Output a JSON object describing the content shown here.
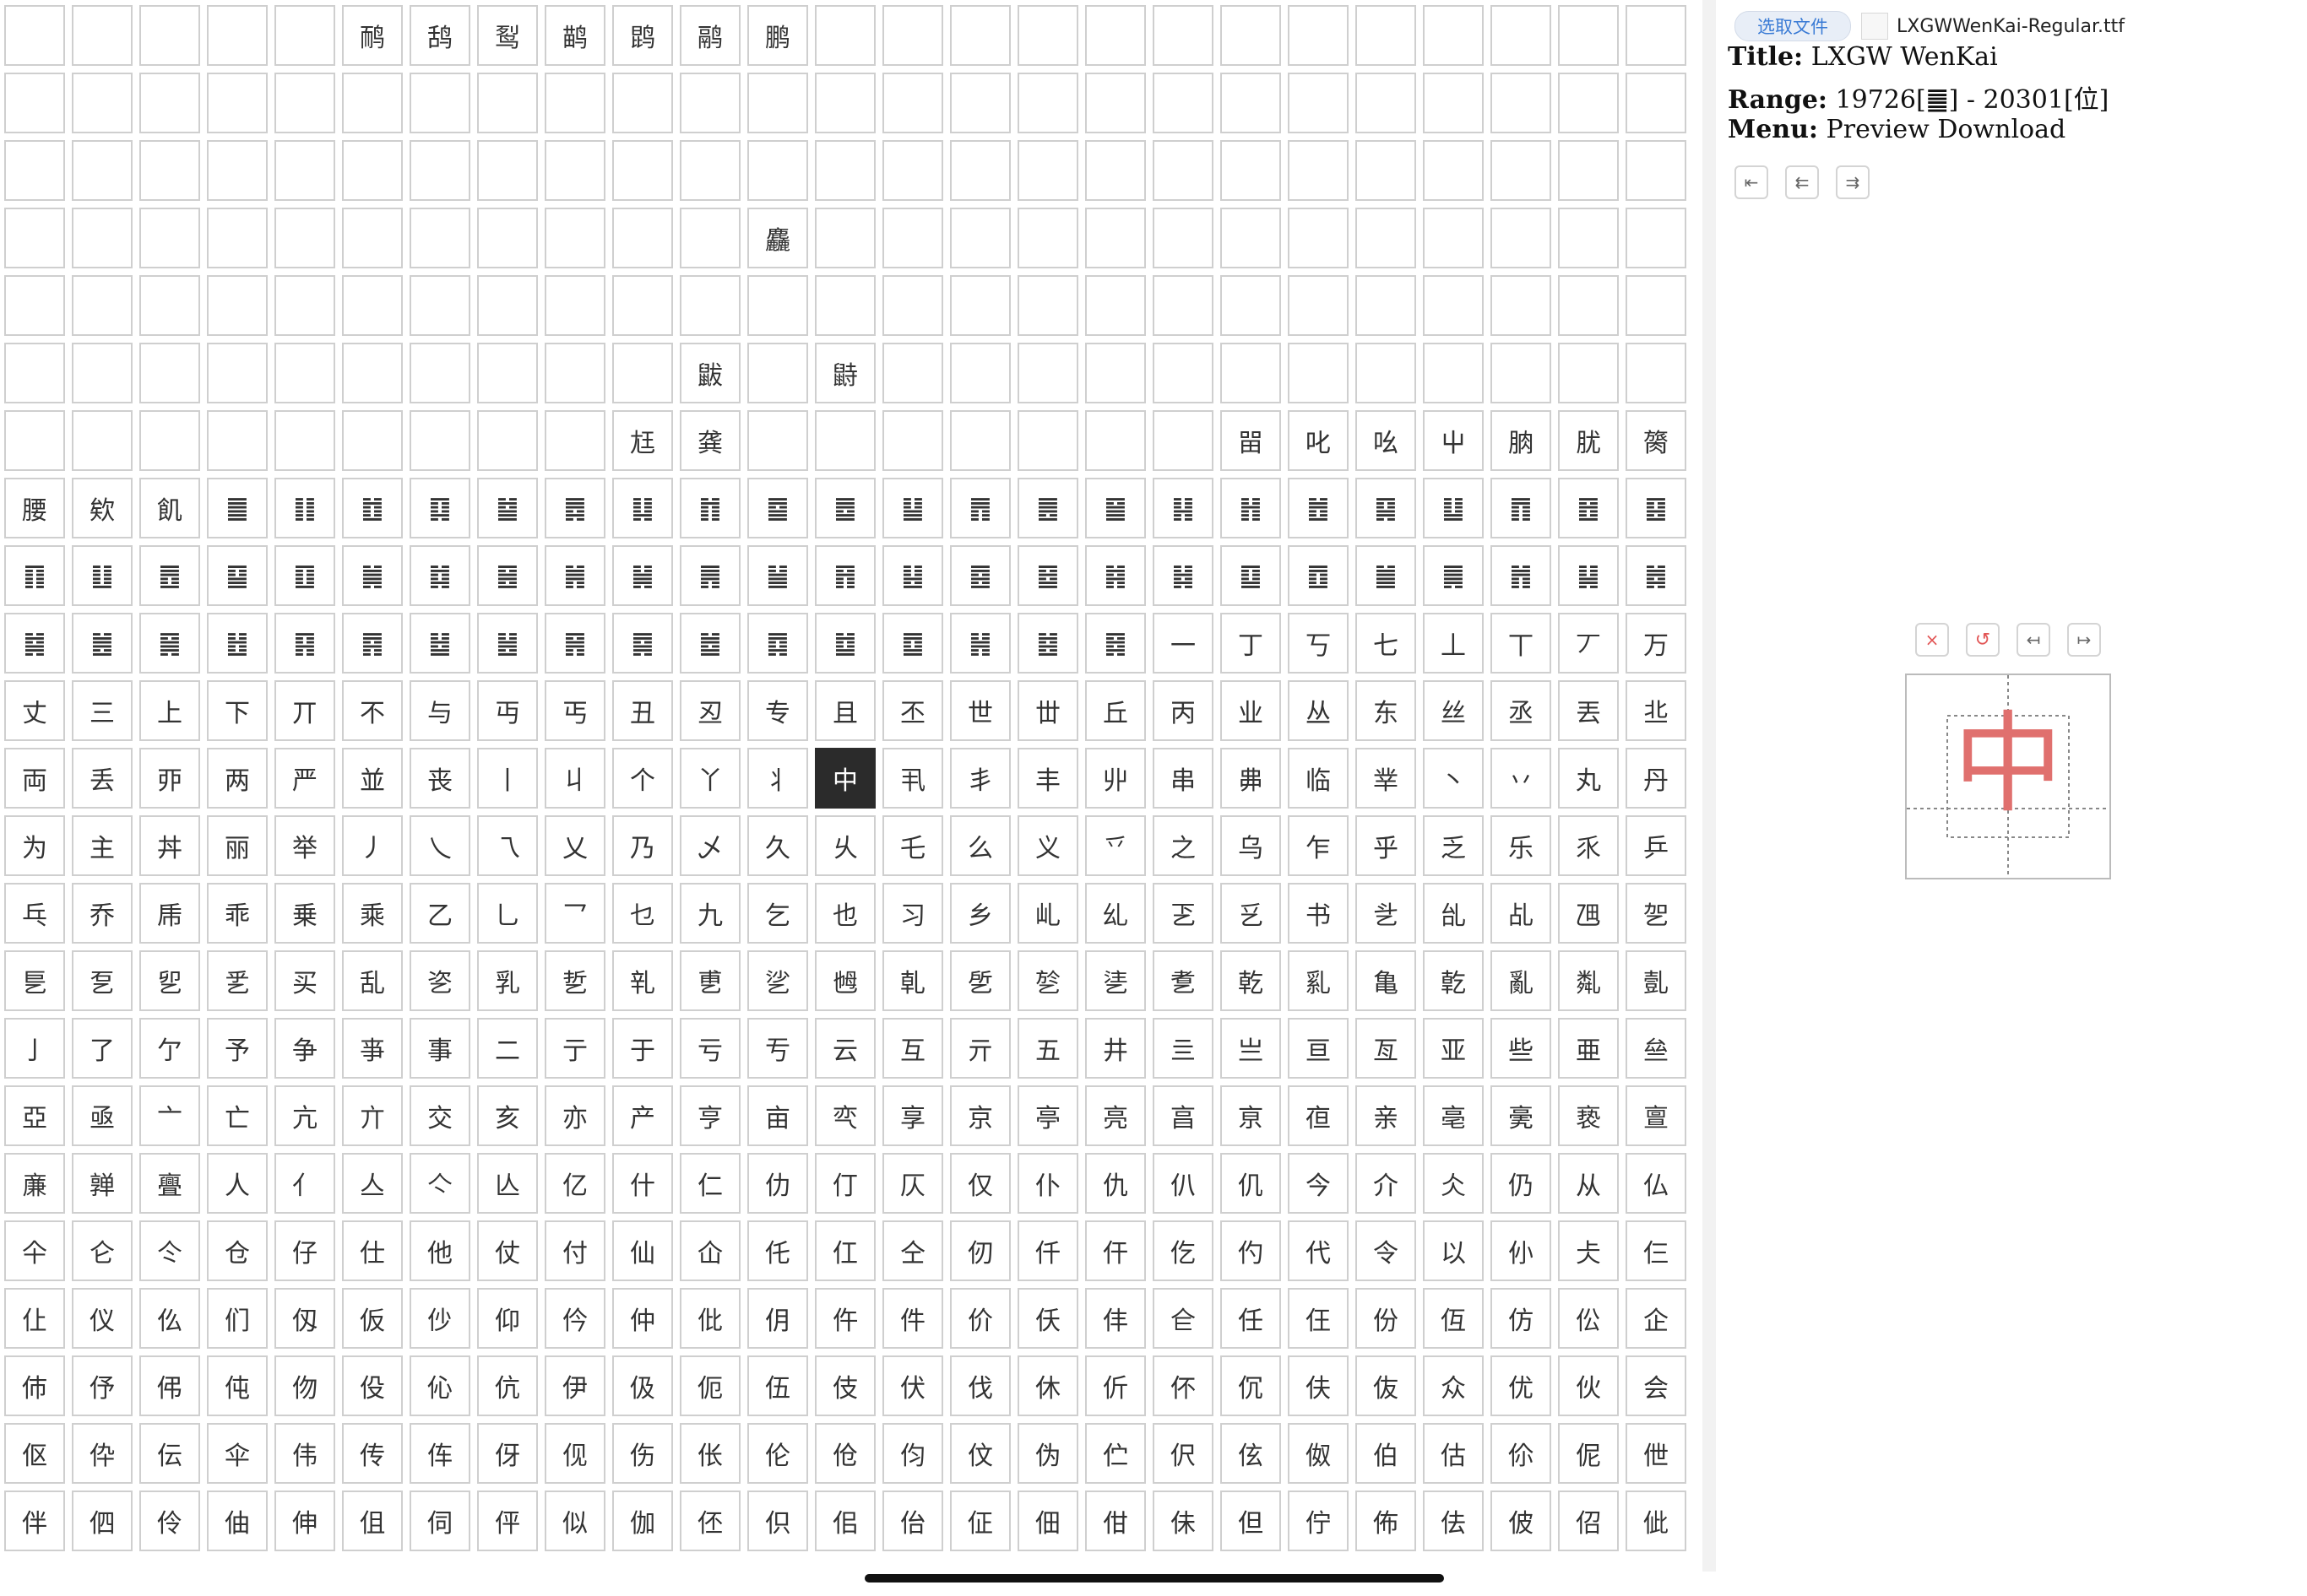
{
  "grid": {
    "selected_index": 287,
    "rows": [
      [
        "",
        "",
        "",
        "",
        "",
        "鸸",
        "鸹",
        "䴕",
        "鹋",
        "鹍",
        "鹝",
        "鹏",
        "",
        "",
        "",
        "",
        "",
        "",
        "",
        "",
        "",
        "",
        "",
        "",
        ""
      ],
      [
        "",
        "",
        "",
        "",
        "",
        "",
        "",
        "",
        "",
        "",
        "",
        "",
        "",
        "",
        "",
        "",
        "",
        "",
        "",
        "",
        "",
        "",
        "",
        "",
        ""
      ],
      [
        "",
        "",
        "",
        "",
        "",
        "",
        "",
        "",
        "",
        "",
        "",
        "",
        "",
        "",
        "",
        "",
        "",
        "",
        "",
        "",
        "",
        "",
        "",
        "",
        ""
      ],
      [
        "",
        "",
        "",
        "",
        "",
        "",
        "",
        "",
        "",
        "",
        "",
        "麤",
        "",
        "",
        "",
        "",
        "",
        "",
        "",
        "",
        "",
        "",
        "",
        "",
        ""
      ],
      [
        "",
        "",
        "",
        "",
        "",
        "",
        "",
        "",
        "",
        "",
        "",
        "",
        "",
        "",
        "",
        "",
        "",
        "",
        "",
        "",
        "",
        "",
        "",
        "",
        ""
      ],
      [
        "",
        "",
        "",
        "",
        "",
        "",
        "",
        "",
        "",
        "",
        "鼥",
        "",
        "鼭",
        "",
        "",
        "",
        "",
        "",
        "",
        "",
        "",
        "",
        "",
        "",
        ""
      ],
      [
        "",
        "",
        "",
        "",
        "",
        "",
        "",
        "",
        "",
        "尪",
        "龚",
        "",
        "",
        "",
        "",
        "",
        "",
        "",
        "㽞",
        "叱",
        "吆",
        "屮",
        "朒",
        "肬",
        "膐"
      ],
      [
        "腰",
        "欸",
        "飢",
        "䷀",
        "䷁",
        "䷂",
        "䷃",
        "䷄",
        "䷅",
        "䷆",
        "䷇",
        "䷈",
        "䷉",
        "䷊",
        "䷋",
        "䷌",
        "䷍",
        "䷎",
        "䷏",
        "䷐",
        "䷑",
        "䷒",
        "䷓",
        "䷔",
        "䷕"
      ],
      [
        "䷖",
        "䷗",
        "䷘",
        "䷙",
        "䷚",
        "䷛",
        "䷜",
        "䷝",
        "䷞",
        "䷟",
        "䷠",
        "䷡",
        "䷢",
        "䷣",
        "䷤",
        "䷥",
        "䷦",
        "䷧",
        "䷨",
        "䷩",
        "䷪",
        "䷫",
        "䷬",
        "䷭",
        "䷮"
      ],
      [
        "䷯",
        "䷰",
        "䷱",
        "䷲",
        "䷳",
        "䷴",
        "䷵",
        "䷶",
        "䷷",
        "䷸",
        "䷹",
        "䷺",
        "䷻",
        "䷼",
        "䷽",
        "䷾",
        "䷿",
        "一",
        "丁",
        "丂",
        "七",
        "丄",
        "丅",
        "丆",
        "万"
      ],
      [
        "丈",
        "三",
        "上",
        "下",
        "丌",
        "不",
        "与",
        "丏",
        "丐",
        "丑",
        "丒",
        "专",
        "且",
        "丕",
        "世",
        "丗",
        "丘",
        "丙",
        "业",
        "丛",
        "东",
        "丝",
        "丞",
        "丟",
        "丠"
      ],
      [
        "両",
        "丢",
        "丣",
        "两",
        "严",
        "並",
        "丧",
        "丨",
        "丩",
        "个",
        "丫",
        "丬",
        "中",
        "丮",
        "丯",
        "丰",
        "丱",
        "串",
        "丳",
        "临",
        "丵",
        "丶",
        "丷",
        "丸",
        "丹"
      ],
      [
        "为",
        "主",
        "丼",
        "丽",
        "举",
        "丿",
        "乀",
        "乁",
        "乂",
        "乃",
        "乄",
        "久",
        "乆",
        "乇",
        "么",
        "义",
        "乊",
        "之",
        "乌",
        "乍",
        "乎",
        "乏",
        "乐",
        "乑",
        "乒"
      ],
      [
        "乓",
        "乔",
        "乕",
        "乖",
        "乗",
        "乘",
        "乙",
        "乚",
        "乛",
        "乜",
        "九",
        "乞",
        "也",
        "习",
        "乡",
        "乢",
        "乣",
        "乤",
        "乥",
        "书",
        "乧",
        "乨",
        "乩",
        "乪",
        "乫"
      ],
      [
        "乬",
        "乭",
        "乮",
        "乯",
        "买",
        "乱",
        "乲",
        "乳",
        "乴",
        "乵",
        "乶",
        "乷",
        "乸",
        "乹",
        "乺",
        "乻",
        "乼",
        "乽",
        "乾",
        "乿",
        "亀",
        "亁",
        "亂",
        "亃",
        "亄"
      ],
      [
        "亅",
        "了",
        "亇",
        "予",
        "争",
        "亊",
        "事",
        "二",
        "亍",
        "于",
        "亏",
        "亐",
        "云",
        "互",
        "亓",
        "五",
        "井",
        "亖",
        "亗",
        "亘",
        "亙",
        "亚",
        "些",
        "亜",
        "亝"
      ],
      [
        "亞",
        "亟",
        "亠",
        "亡",
        "亢",
        "亣",
        "交",
        "亥",
        "亦",
        "产",
        "亨",
        "亩",
        "亪",
        "享",
        "京",
        "亭",
        "亮",
        "亯",
        "亰",
        "亱",
        "亲",
        "亳",
        "亴",
        "亵",
        "亶"
      ],
      [
        "亷",
        "亸",
        "亹",
        "人",
        "亻",
        "亼",
        "亽",
        "亾",
        "亿",
        "什",
        "仁",
        "仂",
        "仃",
        "仄",
        "仅",
        "仆",
        "仇",
        "仈",
        "仉",
        "今",
        "介",
        "仌",
        "仍",
        "从",
        "仏"
      ],
      [
        "仐",
        "仑",
        "仒",
        "仓",
        "仔",
        "仕",
        "他",
        "仗",
        "付",
        "仙",
        "仚",
        "仛",
        "仜",
        "仝",
        "仞",
        "仟",
        "仠",
        "仡",
        "仢",
        "代",
        "令",
        "以",
        "仦",
        "仧",
        "仨"
      ],
      [
        "仩",
        "仪",
        "仫",
        "们",
        "仭",
        "仮",
        "仯",
        "仰",
        "仱",
        "仲",
        "仳",
        "仴",
        "仵",
        "件",
        "价",
        "仸",
        "仹",
        "仺",
        "任",
        "仼",
        "份",
        "仾",
        "仿",
        "伀",
        "企"
      ],
      [
        "伂",
        "伃",
        "伄",
        "伅",
        "伆",
        "伇",
        "伈",
        "伉",
        "伊",
        "伋",
        "伌",
        "伍",
        "伎",
        "伏",
        "伐",
        "休",
        "伒",
        "伓",
        "伔",
        "伕",
        "伖",
        "众",
        "优",
        "伙",
        "会"
      ],
      [
        "伛",
        "伜",
        "伝",
        "伞",
        "伟",
        "传",
        "伡",
        "伢",
        "伣",
        "伤",
        "伥",
        "伦",
        "伧",
        "伨",
        "伩",
        "伪",
        "伫",
        "伬",
        "伭",
        "伮",
        "伯",
        "估",
        "伱",
        "伲",
        "伳"
      ],
      [
        "伴",
        "伵",
        "伶",
        "伷",
        "伸",
        "伹",
        "伺",
        "伻",
        "似",
        "伽",
        "伾",
        "伿",
        "佀",
        "佁",
        "佂",
        "佃",
        "佄",
        "佅",
        "但",
        "佇",
        "佈",
        "佉",
        "佊",
        "佋",
        "佌"
      ]
    ]
  },
  "file": {
    "button_label": "选取文件",
    "name": "LXGWWenKai-Regular.ttf"
  },
  "info": {
    "title_label": "Title:",
    "title_value": "LXGW WenKai",
    "range_label": "Range:",
    "range_value": "19726[䷀] - 20301[位]",
    "menu_label": "Menu:",
    "menu_value": "Preview Download"
  },
  "nav": {
    "first_icon": "⇤",
    "prev_icon": "⇇",
    "next_icon": "⇉"
  },
  "editor": {
    "close_icon": "×",
    "reset_icon": "↺",
    "shrink_icon": "↤",
    "expand_icon": "↦",
    "preview_char": "中",
    "preview_color": "#e0706e"
  }
}
